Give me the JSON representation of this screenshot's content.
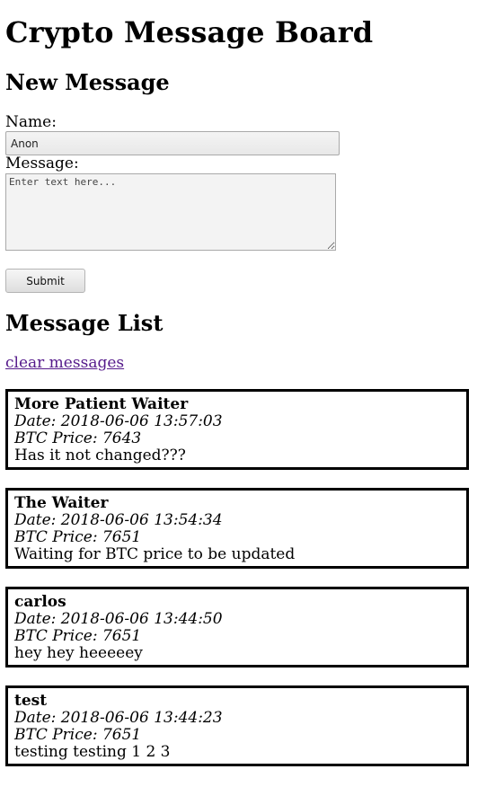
{
  "page": {
    "title": "Crypto Message Board"
  },
  "form": {
    "heading": "New Message",
    "name_label": "Name:",
    "name_value": "Anon",
    "message_label": "Message:",
    "message_placeholder": "Enter text here...",
    "submit_label": "Submit"
  },
  "list": {
    "heading": "Message List",
    "clear_link": "clear messages",
    "messages": [
      {
        "author": "More Patient Waiter",
        "date": "Date: 2018-06-06 13:57:03",
        "price": "BTC Price: 7643",
        "body": "Has it not changed???"
      },
      {
        "author": "The Waiter",
        "date": "Date: 2018-06-06 13:54:34",
        "price": "BTC Price: 7651",
        "body": "Waiting for BTC price to be updated"
      },
      {
        "author": "carlos",
        "date": "Date: 2018-06-06 13:44:50",
        "price": "BTC Price: 7651",
        "body": "hey hey heeeeey"
      },
      {
        "author": "test",
        "date": "Date: 2018-06-06 13:44:23",
        "price": "BTC Price: 7651",
        "body": "testing testing 1 2 3"
      }
    ]
  },
  "colors": {
    "link_visited": "#551a8b",
    "card_border": "#000000"
  }
}
